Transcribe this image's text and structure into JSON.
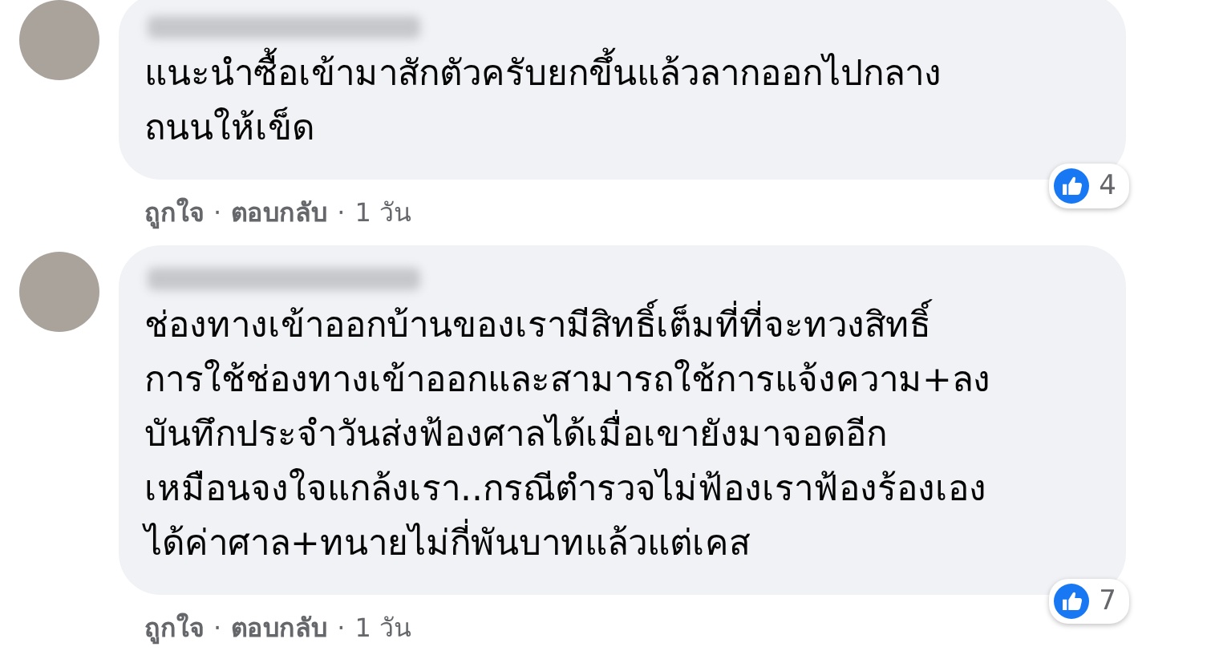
{
  "comments": [
    {
      "text_lines": [
        "แนะนำซื้อเข้ามาสักตัวครับยกขึ้นแล้วลากออกไปกลาง",
        "ถนนให้เข็ด"
      ],
      "reaction_count": "4",
      "actions": [
        "ถูกใจ",
        "ตอบกลับ",
        "1 วัน"
      ],
      "separator": "·"
    },
    {
      "text_lines": [
        "ช่องทางเข้าออกบ้านของเรามีสิทธิ์เต็มที่ที่จะทวงสิทธิ์",
        "การใช้ช่องทางเข้าออกและสามารถใช้การแจ้งความ+ลง",
        "บันทึกประจำวันส่งฟ้องศาลได้เมื่อเขายังมาจอดอีก",
        "เหมือนจงใจแกล้งเรา..กรณีตำรวจไม่ฟ้องเราฟ้องร้องเอง",
        "ได้ค่าศาล+ทนายไม่กี่พันบาทแล้วแต่เคส"
      ],
      "reaction_count": "7",
      "actions": [
        "ถูกใจ",
        "ตอบกลับ",
        "1 วัน"
      ],
      "separator": "·"
    }
  ]
}
